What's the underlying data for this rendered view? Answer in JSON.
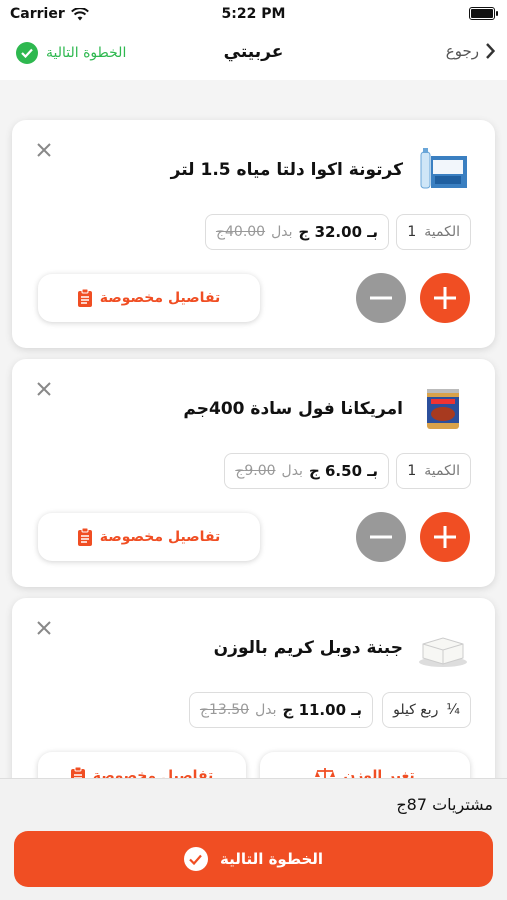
{
  "status_bar": {
    "carrier": "Carrier",
    "time": "5:22 PM"
  },
  "nav": {
    "next_label": "الخطوة التالية",
    "title": "عربيتي",
    "back_label": "رجوع"
  },
  "cart_items": [
    {
      "name": "كرتونة اكوا دلتا مياه 1.5 لتر",
      "image_icon": "water-bottle-carton-icon",
      "qty_label": "الكمية",
      "qty_value": "1",
      "price": "بـ 32.00 ج",
      "instead_label": "بدل",
      "old_price": "40.00ج",
      "details_label": "تفاصيل مخصوصة"
    },
    {
      "name": "امريكانا فول سادة 400جم",
      "image_icon": "fava-beans-can-icon",
      "qty_label": "الكمية",
      "qty_value": "1",
      "price": "بـ 6.50 ج",
      "instead_label": "بدل",
      "old_price": "9.00ج",
      "details_label": "تفاصيل مخصوصة"
    },
    {
      "name": "جبنة دوبل كريم بالوزن",
      "image_icon": "cheese-block-icon",
      "qty_label": "ربع كيلو",
      "qty_value": "¼",
      "price": "بـ 11.00 ج",
      "instead_label": "بدل",
      "old_price": "13.50ج",
      "details_label": "تفاصيل مخصوصة",
      "weight_label": "تغير الوزن"
    }
  ],
  "footer": {
    "total_label": "مشتريات 87ج",
    "next_button_label": "الخطوة التالية"
  },
  "colors": {
    "accent": "#f04e23",
    "success": "#2eb84f",
    "minus_gray": "#999999"
  }
}
